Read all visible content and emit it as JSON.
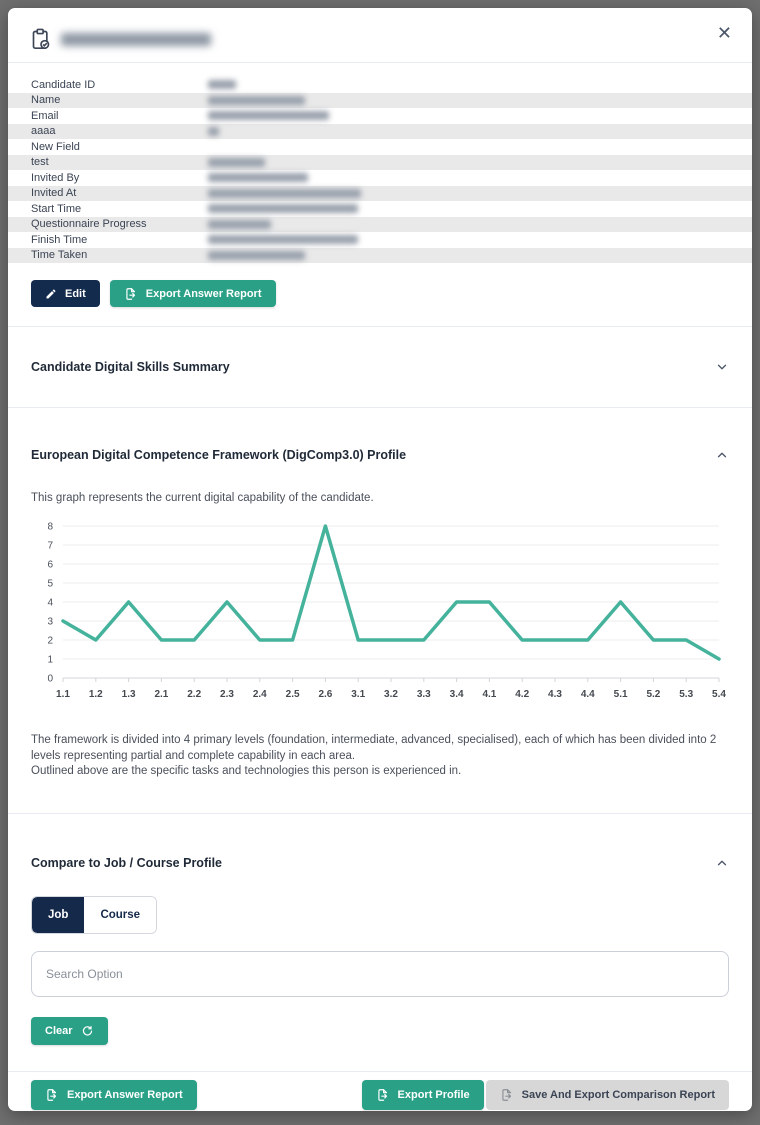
{
  "modal": {
    "header": {
      "name_redacted": true
    },
    "icons": {
      "close": "✕"
    },
    "details": {
      "rows": [
        {
          "label": "Candidate ID",
          "redacted_width": 28
        },
        {
          "label": "Name",
          "redacted_width": 97
        },
        {
          "label": "Email",
          "redacted_width": 121
        },
        {
          "label": "aaaa",
          "redacted_width": 11
        },
        {
          "label": "New Field",
          "redacted_width": 0
        },
        {
          "label": "test",
          "redacted_width": 57
        },
        {
          "label": "Invited By",
          "redacted_width": 100
        },
        {
          "label": "Invited At",
          "redacted_width": 153
        },
        {
          "label": "Start Time",
          "redacted_width": 150
        },
        {
          "label": "Questionnaire Progress",
          "redacted_width": 63
        },
        {
          "label": "Finish Time",
          "redacted_width": 150
        },
        {
          "label": "Time Taken",
          "redacted_width": 97
        }
      ]
    },
    "actions": {
      "edit_label": "Edit",
      "export_answer_report_label": "Export Answer Report"
    },
    "sections": {
      "skills_summary": {
        "title": "Candidate Digital Skills Summary",
        "collapsed": true
      },
      "digcomp": {
        "title": "European Digital Competence Framework (DigComp3.0) Profile",
        "description": "This graph represents the current digital capability of the candidate.",
        "footnote_line1": "The framework is divided into 4 primary levels (foundation, intermediate, advanced, specialised), each of which has been divided into 2 levels representing partial and complete capability in each area.",
        "footnote_line2": "Outlined above are the specific tasks and technologies this person is experienced in."
      },
      "compare": {
        "title": "Compare to Job / Course Profile",
        "tab_job": "Job",
        "tab_course": "Course",
        "active_tab": "Job",
        "search_placeholder": "Search Option",
        "clear_label": "Clear"
      }
    },
    "footer": {
      "export_answer_report_label": "Export Answer Report",
      "export_profile_label": "Export Profile",
      "save_and_export_label": "Save And Export Comparison Report"
    }
  },
  "chart_data": {
    "type": "line",
    "title": "European Digital Competence Framework (DigComp3.0) Profile",
    "categories": [
      "1.1",
      "1.2",
      "1.3",
      "2.1",
      "2.2",
      "2.3",
      "2.4",
      "2.5",
      "2.6",
      "3.1",
      "3.2",
      "3.3",
      "3.4",
      "4.1",
      "4.2",
      "4.3",
      "4.4",
      "5.1",
      "5.2",
      "5.3",
      "5.4"
    ],
    "values": [
      3,
      2,
      4,
      2,
      2,
      4,
      2,
      2,
      8,
      2,
      2,
      2,
      4,
      4,
      2,
      2,
      2,
      4,
      2,
      2,
      1
    ],
    "xlabel": "",
    "ylabel": "",
    "ylim": [
      0,
      8
    ],
    "y_ticks": [
      0,
      1,
      2,
      3,
      4,
      5,
      6,
      7,
      8
    ],
    "grid": true,
    "legend": false
  },
  "colors": {
    "accent_teal": "#2aa187",
    "navy": "#15294a",
    "chart_line": "#45b39c",
    "row_stripe": "#e9e9e9",
    "backdrop": "#6f6f6f"
  }
}
